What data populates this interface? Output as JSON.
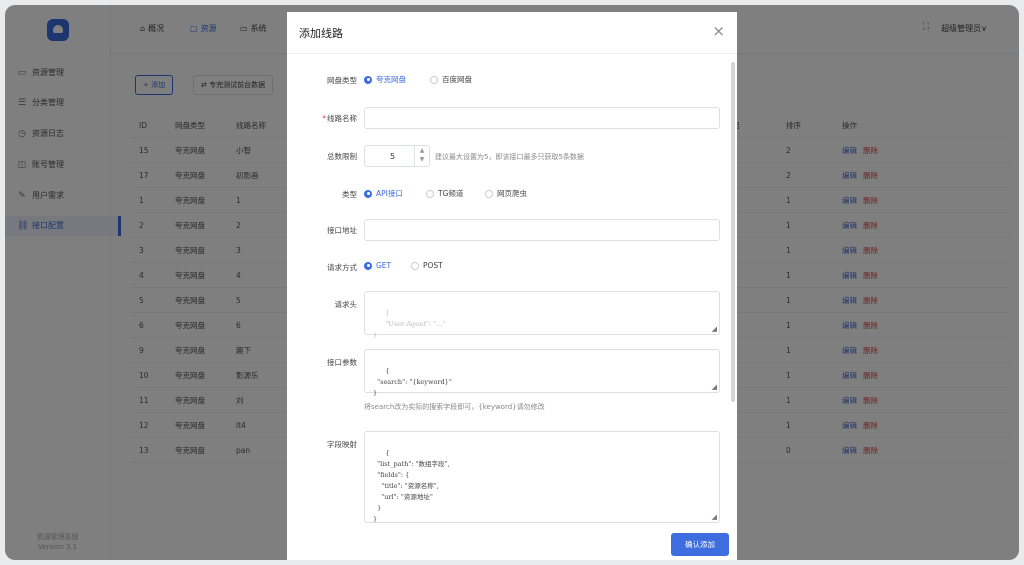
{
  "sidebar": {
    "items": [
      {
        "icon": "folder-icon",
        "glyph": "▭",
        "label": "资源管理"
      },
      {
        "icon": "list-icon",
        "glyph": "☰",
        "label": "分类管理"
      },
      {
        "icon": "clock-icon",
        "glyph": "◷",
        "label": "资源日志"
      },
      {
        "icon": "user-icon",
        "glyph": "◫",
        "label": "账号管理"
      },
      {
        "icon": "request-icon",
        "glyph": "✎",
        "label": "用户需求"
      },
      {
        "icon": "link-icon",
        "glyph": "⛓",
        "label": "接口配置"
      }
    ],
    "version_line1": "资源管理系统",
    "version_line2": "Version 3.1"
  },
  "topnav": {
    "items": [
      {
        "icon": "home-icon",
        "glyph": "⌂",
        "label": "概况"
      },
      {
        "icon": "box-icon",
        "glyph": "▢",
        "label": "资源"
      },
      {
        "icon": "monitor-icon",
        "glyph": "▭",
        "label": "系统"
      }
    ],
    "fullscreen_glyph": "⛶",
    "admin": "超级管理员∨"
  },
  "toolbar": {
    "add": "+ 添加",
    "test": "⇄ 专完测试前台数据"
  },
  "table": {
    "headers": [
      "ID",
      "网盘类型",
      "线路名称",
      "是否开启",
      "排序",
      "操作"
    ],
    "rows": [
      {
        "id": "15",
        "type": "夸克网盘",
        "name": "小智",
        "on": true,
        "sort": "2"
      },
      {
        "id": "17",
        "type": "夸克网盘",
        "name": "初影画",
        "on": true,
        "sort": "2"
      },
      {
        "id": "1",
        "type": "夸克网盘",
        "name": "1",
        "on": false,
        "sort": "1"
      },
      {
        "id": "2",
        "type": "夸克网盘",
        "name": "2",
        "on": false,
        "sort": "1"
      },
      {
        "id": "3",
        "type": "夸克网盘",
        "name": "3",
        "on": false,
        "sort": "1"
      },
      {
        "id": "4",
        "type": "夸克网盘",
        "name": "4",
        "on": false,
        "sort": "1"
      },
      {
        "id": "5",
        "type": "夸克网盘",
        "name": "5",
        "on": false,
        "sort": "1"
      },
      {
        "id": "6",
        "type": "夸克网盘",
        "name": "6",
        "on": false,
        "sort": "1"
      },
      {
        "id": "9",
        "type": "夸克网盘",
        "name": "趣下",
        "on": true,
        "sort": "1"
      },
      {
        "id": "10",
        "type": "夸克网盘",
        "name": "影源乐",
        "on": true,
        "sort": "1"
      },
      {
        "id": "11",
        "type": "夸克网盘",
        "name": "刘",
        "on": false,
        "sort": "1"
      },
      {
        "id": "12",
        "type": "夸克网盘",
        "name": "lt4",
        "on": true,
        "sort": "1"
      },
      {
        "id": "13",
        "type": "夸克网盘",
        "name": "pan",
        "on": false,
        "sort": "0"
      }
    ],
    "edit": "编辑",
    "delete": "删除"
  },
  "modal": {
    "title": "添加线路",
    "close": "×",
    "disk_type_label": "网盘类型",
    "disk_options": [
      "夸克网盘",
      "百度网盘"
    ],
    "name_label": "线路名称",
    "limit_label": "总数限制",
    "limit_value": "5",
    "limit_hint": "建议最大设置为5，即该接口最多只获取5条数据",
    "type_label": "类型",
    "type_options": [
      "API接口",
      "TG频道",
      "网页爬虫"
    ],
    "url_label": "接口地址",
    "method_label": "请求方式",
    "method_options": [
      "GET",
      "POST"
    ],
    "headers_label": "请求头",
    "headers_placeholder": "{\n      \"User-Agent\": \"...\"\n}",
    "params_label": "接口参数",
    "params_value": "{\n  \"search\": \"{keyword}\"\n}",
    "params_hint": "将search改为实际的搜索字段即可，{keyword}请勿修改",
    "mapping_label": "字段映射",
    "mapping_value": "{\n  \"list_path\": \"数组字段\",\n  \"fields\": {\n    \"title\": \"资源名称\",\n    \"url\": \"资源地址\"\n  }\n}",
    "confirm": "确认添加"
  }
}
